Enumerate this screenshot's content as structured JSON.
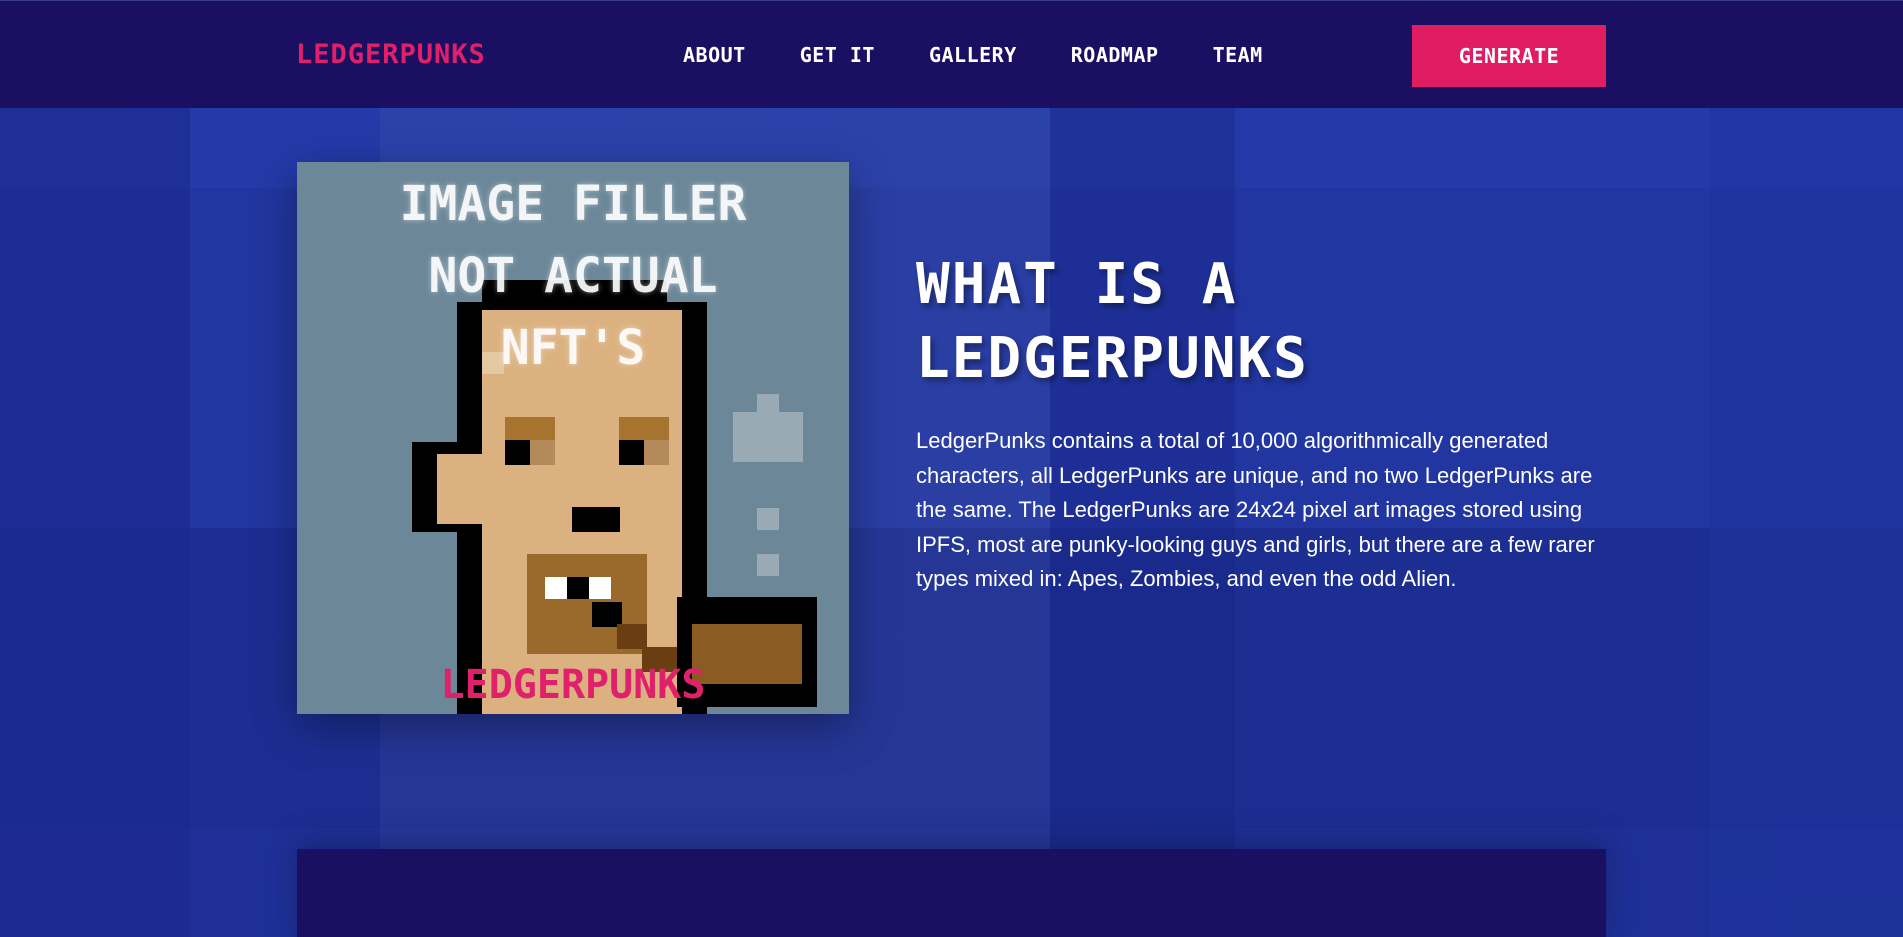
{
  "nav": {
    "brand": "LEDGERPUNKS",
    "items": [
      {
        "label": "ABOUT"
      },
      {
        "label": "GET IT"
      },
      {
        "label": "GALLERY"
      },
      {
        "label": "ROADMAP"
      },
      {
        "label": "TEAM"
      }
    ],
    "cta_label": "GENERATE"
  },
  "hero": {
    "image": {
      "overlay_lines": [
        "IMAGE FILLER",
        "NOT ACTUAL",
        "NFT'S"
      ],
      "watermark": "LEDGERPUNKS"
    },
    "title_lines": [
      "WHAT IS A",
      "LEDGERPUNKS"
    ],
    "description": "LedgerPunks contains a total of 10,000 algorithmically generated characters, all LedgerPunks are unique, and no two LedgerPunks are the same. The LedgerPunks are 24x24 pixel art images stored using IPFS, most are punky-looking guys and girls, but there are a few rarer types mixed in: Apes, Zombies, and even the odd Alien."
  },
  "colors": {
    "nav_bg": "#1b0f62",
    "page_bg": "#2136a0",
    "accent": "#e01c62",
    "text": "#ffffff"
  }
}
